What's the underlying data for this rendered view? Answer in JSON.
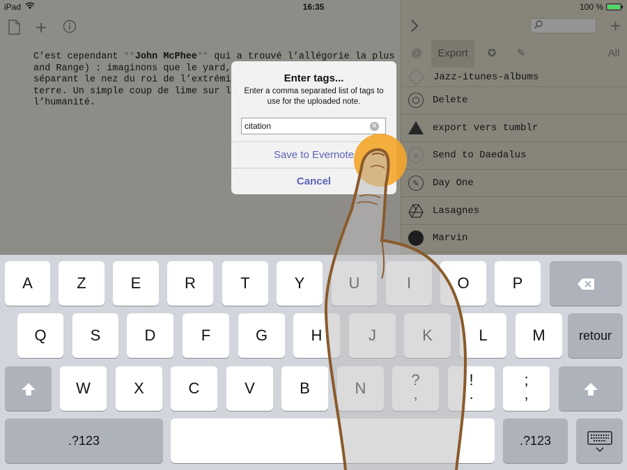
{
  "status_bar": {
    "device": "iPad",
    "time": "16:35",
    "battery": "100 %"
  },
  "editor": {
    "line1_pre": "C’est cependant ",
    "line1_mk1": "**",
    "line1_bold": "John McPhee",
    "line1_mk2": "**",
    "line1_post": " qui a trouvé l’allégorie la plus sa",
    "line2": "and Range) : imaginons que le yard, l",
    "line3": "séparant le nez du roi de l’extrémit",
    "line4": "terre. Un simple coup de lime sur l’",
    "line5": "l’humanité."
  },
  "panel": {
    "tabs": {
      "at": "@",
      "export": "Export",
      "star": "✪",
      "pencil": "✎",
      "all": "All"
    },
    "items": [
      {
        "label": "Jazz-itunes-albums",
        "icon": "dropbox-icon"
      },
      {
        "label": "Delete",
        "icon": "target-icon"
      },
      {
        "label": "export vers tumblr",
        "icon": "triangle-icon"
      },
      {
        "label": "Send to Daedalus",
        "icon": "link-icon"
      },
      {
        "label": "Day One",
        "icon": "pen-icon"
      },
      {
        "label": "Lasagnes",
        "icon": "drive-icon"
      },
      {
        "label": "Marvin",
        "icon": "circle-icon"
      }
    ]
  },
  "alert": {
    "title": "Enter tags...",
    "message": "Enter a comma separated list of tags to use for the uploaded note.",
    "input_value": "citation",
    "save_label": "Save to Evernote",
    "cancel_label": "Cancel"
  },
  "keyboard": {
    "row1": [
      "A",
      "Z",
      "E",
      "R",
      "T",
      "Y",
      "U",
      "I",
      "O",
      "P"
    ],
    "row2": [
      "Q",
      "S",
      "D",
      "F",
      "G",
      "H",
      "J",
      "K",
      "L",
      "M"
    ],
    "row3": [
      "W",
      "X",
      "C",
      "V",
      "B",
      "N"
    ],
    "punct1_top": "?",
    "punct1_bottom": ",",
    "punct2_top": "!",
    "punct2_bottom": ".",
    "punct3_top": ";",
    "punct3_bottom": ",",
    "return_label": "retour",
    "numbers_label": ".?123",
    "backspace": "⌫",
    "shift": "⇧"
  },
  "colors": {
    "accent": "#5b63b6",
    "finger_outline": "#8b5a2b",
    "touch": "#f4a62a"
  }
}
